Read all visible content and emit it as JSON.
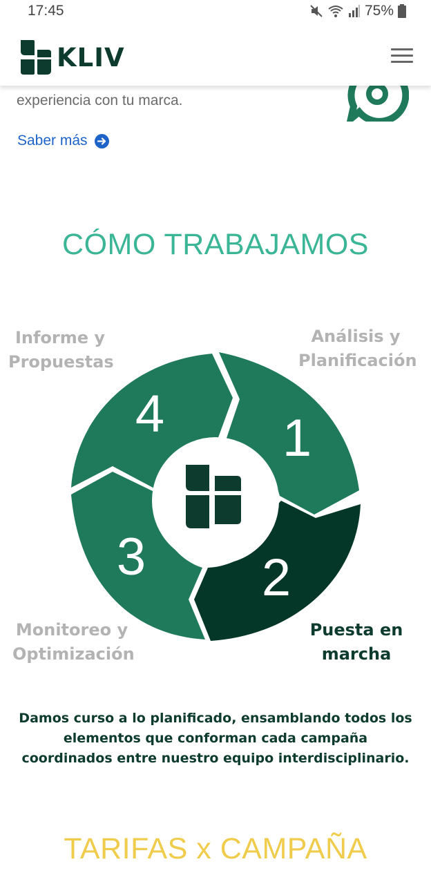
{
  "status_bar": {
    "time": "17:45",
    "battery": "75%"
  },
  "header": {
    "logo_text": "KLIV"
  },
  "intro": {
    "text": "experiencia con tu marca.",
    "link_label": "Saber más"
  },
  "how_we_work": {
    "title": "CÓMO TRABAJAMOS",
    "steps": [
      {
        "number": "1",
        "label": "Análisis y Planificación",
        "label_line1": "Análisis y",
        "label_line2": "Planificación",
        "active": false
      },
      {
        "number": "2",
        "label": "Puesta en marcha",
        "label_line1": "Puesta en",
        "label_line2": "marcha",
        "active": true
      },
      {
        "number": "3",
        "label": "Monitoreo y Optimización",
        "label_line1": "Monitoreo y",
        "label_line2": "Optimización",
        "active": false
      },
      {
        "number": "4",
        "label": "Informe y Propuestas",
        "label_line1": "Informe y",
        "label_line2": "Propuestas",
        "active": false
      }
    ],
    "description": "Damos curso a lo planificado, ensamblando todos los elementos que conforman cada campaña coordinados entre nuestro equipo interdisciplinario."
  },
  "pricing": {
    "title": "TARIFAS x CAMPAÑA"
  },
  "colors": {
    "brand_dark": "#0d3b2e",
    "segment_green": "#1f7a5c",
    "active_segment": "#043727",
    "title_teal": "#3ab596",
    "title_yellow": "#f0cc4d",
    "link_blue": "#1e64c8"
  },
  "icons": {
    "mute": "mute-icon",
    "wifi": "wifi-icon",
    "signal": "signal-icon",
    "battery": "battery-icon",
    "menu": "hamburger-menu-icon",
    "arrow": "arrow-right-circle-icon",
    "whatsapp": "whatsapp-gear-icon"
  }
}
